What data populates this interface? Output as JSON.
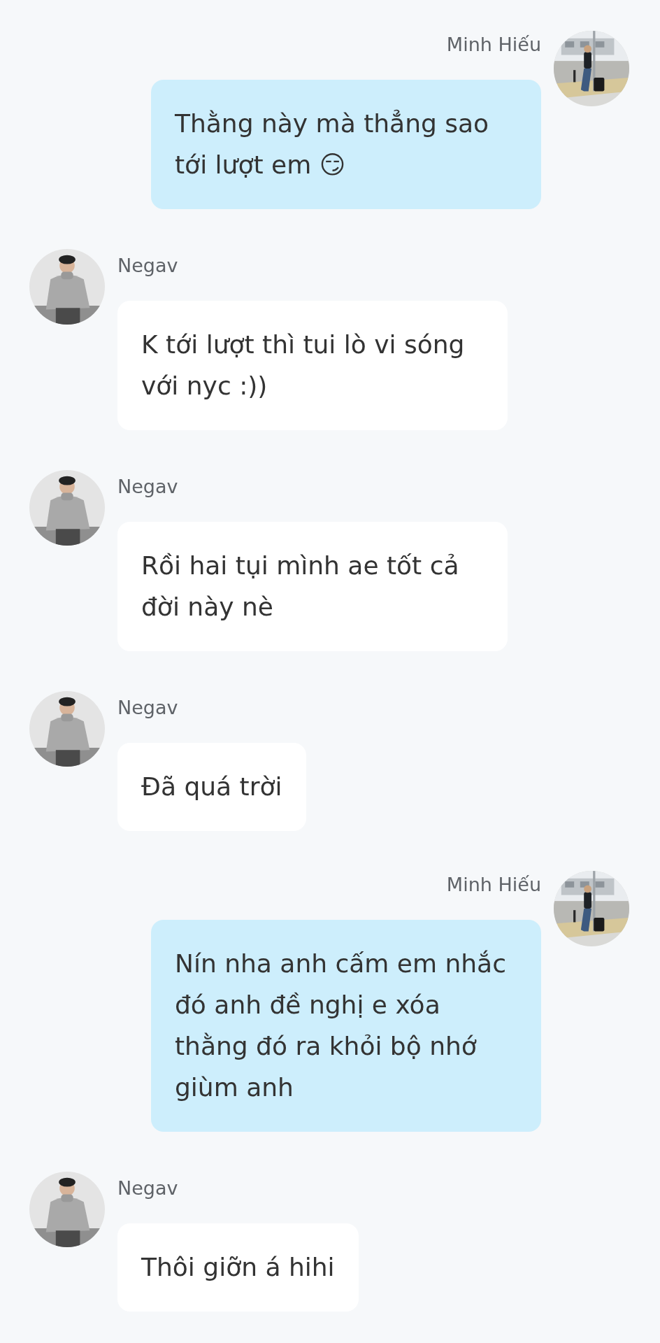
{
  "messages": [
    {
      "kind": "outgoing",
      "sender": "Minh Hiếu",
      "text": "Thằng này mà thẳng sao tới lượt em 😏"
    },
    {
      "kind": "incoming",
      "sender": "Negav",
      "text": "K tới lượt thì tui lò vi sóng với nyc :))"
    },
    {
      "kind": "incoming",
      "sender": "Negav",
      "text": "Rồi hai tụi mình ae tốt cả đời này nè"
    },
    {
      "kind": "incoming",
      "sender": "Negav",
      "text": "Đã quá trời"
    },
    {
      "kind": "outgoing",
      "sender": "Minh Hiếu",
      "text": "Nín nha anh cấm em nhắc đó anh đề nghị e xóa thằng đó ra khỏi bộ nhớ giùm anh"
    },
    {
      "kind": "incoming",
      "sender": "Negav",
      "text": "Thôi giỡn á hihi"
    }
  ]
}
